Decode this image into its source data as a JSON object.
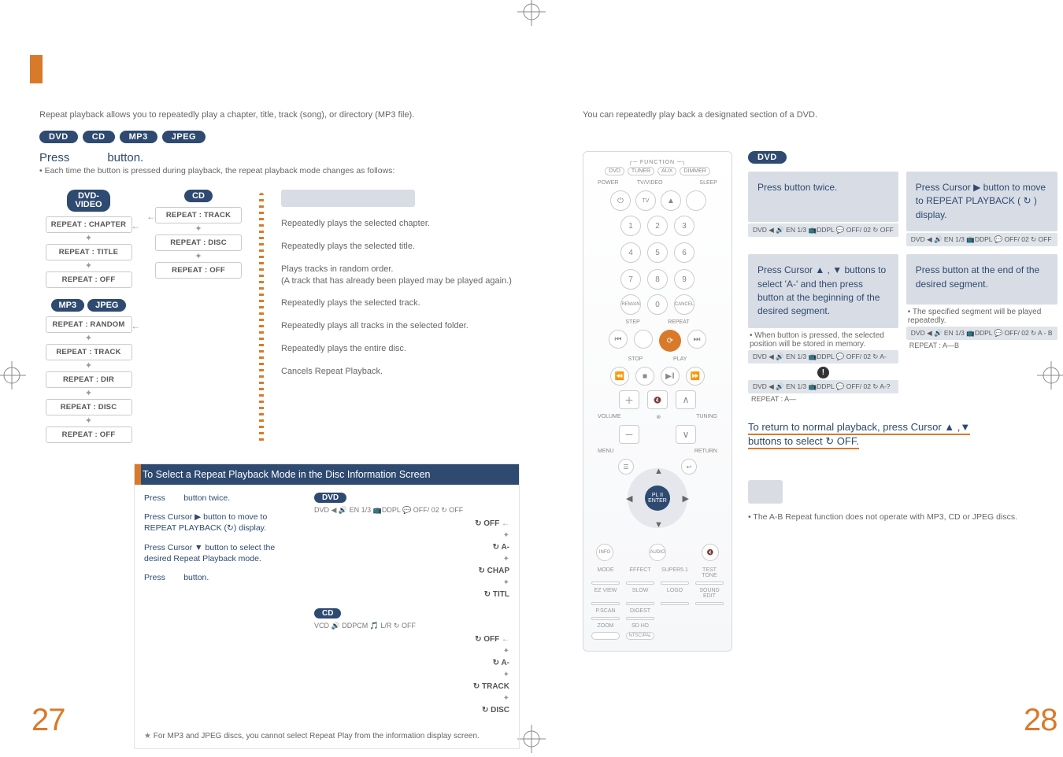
{
  "left": {
    "intro": "Repeat playback allows you to repeatedly play a chapter, title, track (song), or directory (MP3 file).",
    "pills": [
      "DVD",
      "CD",
      "MP3",
      "JPEG"
    ],
    "press_label": "Press",
    "press_button": "button.",
    "sub": "Each time the button is pressed during playback, the repeat playback mode changes as follows:",
    "flows": {
      "dvd_video": {
        "title": "DVD-\nVIDEO",
        "states": [
          "REPEAT : CHAPTER",
          "REPEAT : TITLE",
          "REPEAT : OFF"
        ]
      },
      "cd": {
        "title": "CD",
        "states": [
          "REPEAT : TRACK",
          "REPEAT : DISC",
          "REPEAT : OFF"
        ]
      },
      "mp3jpeg": {
        "titles": [
          "MP3",
          "JPEG"
        ],
        "states": [
          "REPEAT : RANDOM",
          "REPEAT : TRACK",
          "REPEAT : DIR",
          "REPEAT : DISC",
          "REPEAT : OFF"
        ]
      }
    },
    "desc": [
      "Repeatedly plays the selected chapter.",
      "Repeatedly plays the selected title.",
      "Plays tracks in random order.\n(A track that has already been played may be played again.)",
      "Repeatedly plays the selected track.",
      "Repeatedly plays all tracks in the selected folder.",
      "Repeatedly plays the entire disc.",
      "Cancels Repeat Playback."
    ],
    "panel": {
      "title": "To Select a Repeat Playback Mode in the Disc Information Screen",
      "steps": [
        {
          "a": "Press",
          "b": "button twice."
        },
        {
          "a": "Press Cursor ▶ button to move to REPEAT PLAYBACK (↻) display."
        },
        {
          "a": "Press Cursor ▼ button to select the desired Repeat Playback mode."
        },
        {
          "a": "Press",
          "b": "button."
        }
      ],
      "star": "For MP3 and JPEG discs, you cannot select Repeat Play from the information display screen.",
      "dvd_chain": [
        "↻ OFF",
        "↻ A-",
        "↻ CHAP",
        "↻ TITL"
      ],
      "cd_chain": [
        "↻ OFF",
        "↻ A-",
        "↻ TRACK",
        "↻ DISC"
      ],
      "strip_dvd": "DVD ◀ 🔊 EN 1/3 📺DDPL 💬 OFF/ 02 ↻ OFF",
      "strip_cd": "VCD 🔊 DDPCM 🎵 L/R   ↻ OFF"
    },
    "folio": "27"
  },
  "right": {
    "intro": "You can repeatedly play back a designated section of a DVD.",
    "pill": "DVD",
    "steps": [
      {
        "box": "Press         button twice.",
        "strip": "DVD ◀ 🔊 EN 1/3 📺DDPL 💬 OFF/ 02 ↻ OFF"
      },
      {
        "box": "Press Cursor ▶ button to move to REPEAT PLAYBACK ( ↻ ) display.",
        "strip": "DVD ◀ 🔊 EN 1/3 📺DDPL 💬 OFF/ 02 ↻ OFF"
      },
      {
        "box": "Press Cursor ▲ , ▼ buttons to select 'A-' and then press           button at the beginning of the desired segment.",
        "under": "When            button is pressed, the selected position will be stored in memory.",
        "strip1": "DVD ◀ 🔊 EN 1/3 📺DDPL 💬 OFF/ 02 ↻ A-",
        "strip2": "DVD ◀ 🔊 EN 1/3 📺DDPL 💬 OFF/ 02 ↻ A-?",
        "rep1": "REPEAT : A—",
        "rep2": "REPEAT : A—"
      },
      {
        "box": "Press            button at the end of the desired segment.",
        "under": "The specified segment will be played repeatedly.",
        "strip": "DVD ◀ 🔊 EN 1/3 📺DDPL 💬 OFF/ 02 ↻ A - B",
        "rep": "REPEAT : A—B"
      }
    ],
    "callout_a": "To return to normal playback, press Cursor ▲ ,▼",
    "callout_b": "buttons to select ↻ OFF.",
    "note": "The A-B Repeat function does not operate with MP3, CD or JPEG discs.",
    "folio": "28",
    "remote": {
      "function": [
        "DVD",
        "TUNER",
        "AUX",
        "DIMMER"
      ],
      "top_labels": [
        "POWER",
        "TV/VIDEO",
        "OPEN/CLOSE",
        "SLEEP"
      ],
      "bottom_circles": [
        "REMAIN",
        "0",
        "CANCEL"
      ],
      "play_labels": [
        "STEP",
        "REPEAT",
        "STOP",
        "PLAY"
      ],
      "vol_labels": [
        "MUTE",
        "VOLUME",
        "TUNING"
      ],
      "dpad": [
        "MENU",
        "RETURN",
        "PL II ENTER"
      ],
      "lowrow": [
        "INFO",
        "AUDIO",
        "🔇"
      ],
      "label_grid": [
        "MODE",
        "EFFECT",
        "EZ VIEW",
        "SLOW",
        "LOGO",
        "SOUND EDIT",
        "P.SCAN",
        "DIGEST",
        "ZOOM",
        "SD  HD",
        "SUPER5.1",
        "TEST TONE"
      ],
      "btn_minis": [
        "",
        "NTSC/PAL",
        "",
        "",
        "",
        "",
        ""
      ]
    }
  }
}
